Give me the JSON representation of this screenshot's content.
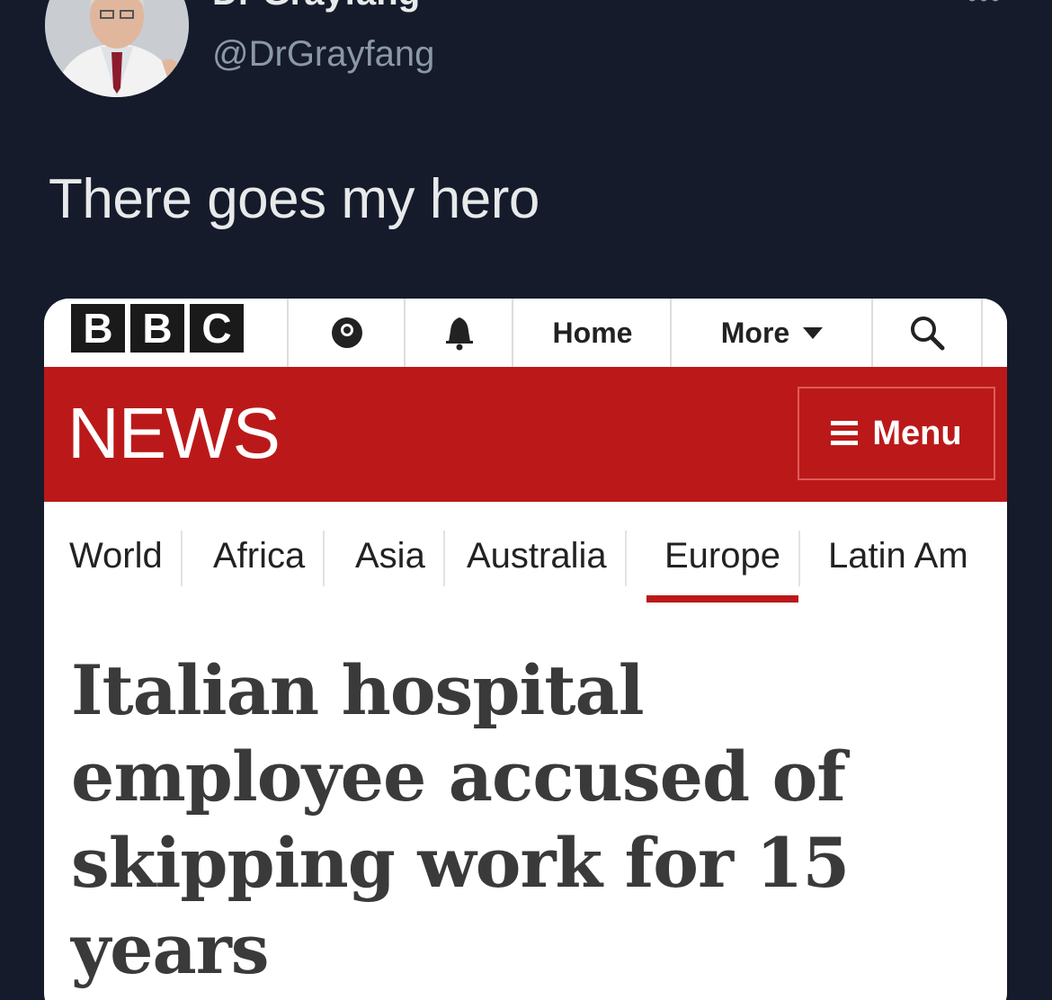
{
  "tweet": {
    "display_name": "Dr Grayfang",
    "handle": "@DrGrayfang",
    "more_icon": "more-horizontal-icon",
    "text": "There goes my hero"
  },
  "bbc": {
    "logo_letters": [
      "B",
      "B",
      "C"
    ],
    "top_nav": {
      "account_icon": "account-icon",
      "notifications_icon": "bell-icon",
      "home_label": "Home",
      "more_label": "More",
      "more_icon": "caret-down-icon",
      "search_icon": "search-icon"
    },
    "section_title": "NEWS",
    "menu_label": "Menu",
    "menu_icon": "hamburger-icon",
    "regions": [
      {
        "label": "World",
        "active": false
      },
      {
        "label": "Africa",
        "active": false
      },
      {
        "label": "Asia",
        "active": false
      },
      {
        "label": "Australia",
        "active": false
      },
      {
        "label": "Europe",
        "active": true
      },
      {
        "label": "Latin Am",
        "active": false
      }
    ],
    "headline": "Italian hospital employee accused of skipping work for 15 years",
    "colors": {
      "brand_red": "#bb1919",
      "background_dark": "#151b2b"
    }
  }
}
